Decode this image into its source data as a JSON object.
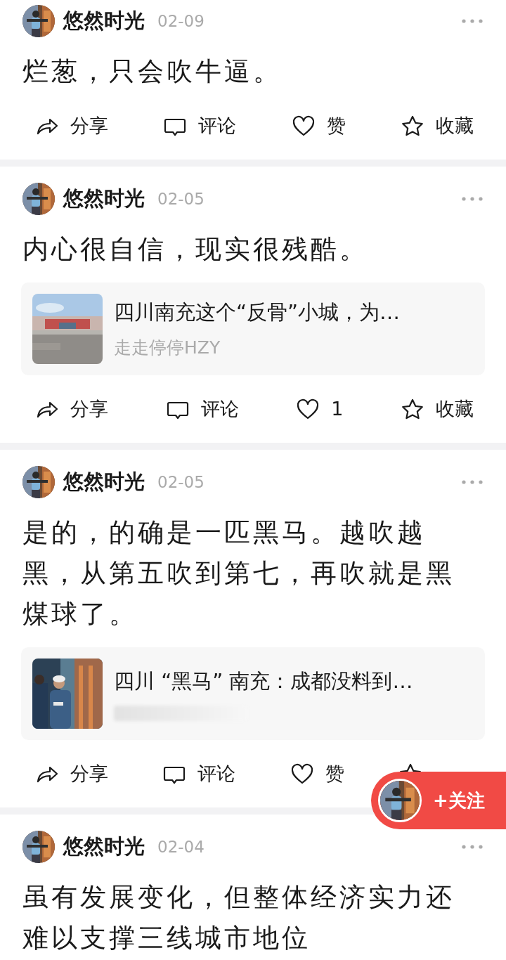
{
  "posts": [
    {
      "author": "悠然时光",
      "date": "02-09",
      "text": "烂葱，只会吹牛逼。",
      "actions": [
        {
          "kind": "share",
          "label": "分享"
        },
        {
          "kind": "comment",
          "label": "评论"
        },
        {
          "kind": "like",
          "label": "赞",
          "selected": false
        },
        {
          "kind": "favorite",
          "label": "收藏",
          "selected": false
        }
      ]
    },
    {
      "author": "悠然时光",
      "date": "02-05",
      "text": "内心很自信，现实很残酷。",
      "link": {
        "kind": "picture",
        "title": "四川南充这个“反骨”小城，为…",
        "source": "走走停停HZY"
      },
      "actions": [
        {
          "kind": "share",
          "label": "分享"
        },
        {
          "kind": "comment",
          "label": "评论"
        },
        {
          "kind": "like",
          "label": "1",
          "selected": false
        },
        {
          "kind": "favorite",
          "label": "收藏",
          "selected": false
        }
      ]
    },
    {
      "author": "悠然时光",
      "date": "02-05",
      "text": "是的，的确是一匹黑马。越吹越黑，从第五吹到第七，再吹就是黑煤球了。",
      "link": {
        "kind": "picture",
        "title": "四川 “黑马” 南充：成都没料到…"
      },
      "actions": [
        {
          "kind": "share",
          "label": "分享"
        },
        {
          "kind": "comment",
          "label": "评论"
        },
        {
          "kind": "like",
          "label": "赞",
          "selected": false
        },
        {
          "kind": "favorite",
          "selected": false
        }
      ]
    },
    {
      "author": "悠然时光",
      "date": "02-04",
      "text": "虽有发展变化，但整体经济实力还难以支撑三线城市地位"
    }
  ],
  "follow_button": {
    "label": "+关注"
  }
}
